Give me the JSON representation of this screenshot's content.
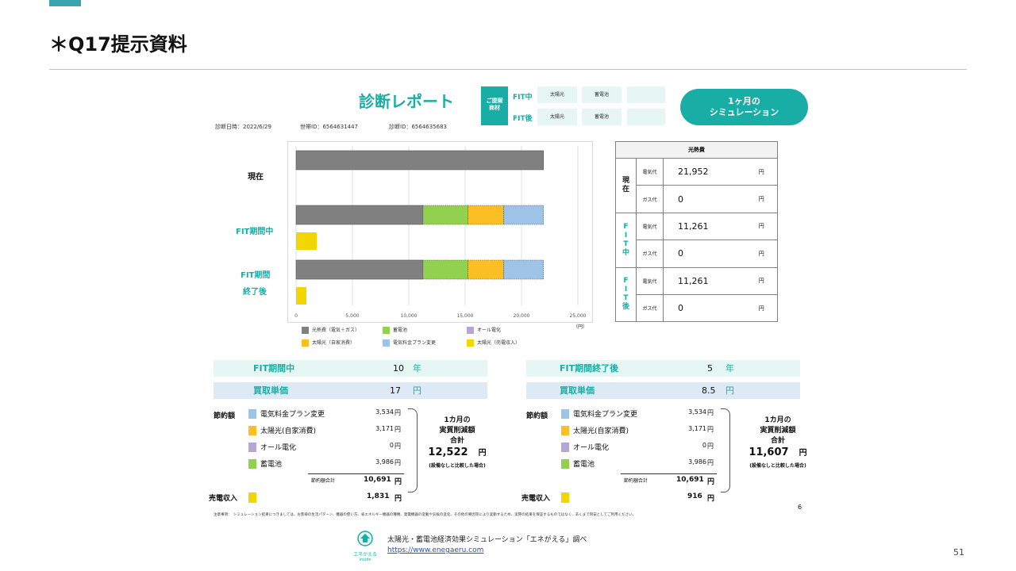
{
  "slide": {
    "title": "＊Q17提示資料",
    "page_number": "51"
  },
  "report": {
    "title": "診断レポート",
    "proposal_label": "ご提案商材",
    "fit_during": "FIT中",
    "fit_after": "FIT後",
    "proposal_items": [
      "太陽光",
      "蓄電池",
      ""
    ],
    "sim_button": [
      "1ヶ月の",
      "シミュレーション"
    ],
    "diag_date": "診断日時：2022/6/29",
    "household_id": "世帯ID：6564631447",
    "diag_id": "診断ID：6564635683"
  },
  "chart_labels": {
    "current": "現在",
    "fit_during": "FIT期間中",
    "fit_after_1": "FIT期間",
    "fit_after_2": "終了後",
    "unit": "（円）"
  },
  "chart_data": {
    "type": "bar",
    "orientation": "horizontal",
    "stacked": true,
    "xlim": [
      0,
      25000
    ],
    "x_ticks": [
      "0",
      "5,000",
      "10,000",
      "15,000",
      "20,000",
      "25,000"
    ],
    "categories": [
      "現在",
      "FIT期間中",
      "FIT期間中（売電）",
      "FIT期間終了後",
      "FIT期間終了後（売電）"
    ],
    "series": [
      {
        "name": "光熱費（電気＋ガス）",
        "color": "#808080",
        "values": [
          21952,
          11261,
          0,
          11261,
          0
        ]
      },
      {
        "name": "蓄電池",
        "color": "#92d050",
        "values": [
          0,
          3986,
          0,
          3986,
          0
        ]
      },
      {
        "name": "オール電化",
        "color": "#b4a7d6",
        "values": [
          0,
          0,
          0,
          0,
          0
        ]
      },
      {
        "name": "太陽光（自家消費）",
        "color": "#fbbf24",
        "values": [
          0,
          3171,
          0,
          3171,
          0
        ]
      },
      {
        "name": "電気料金プラン変更",
        "color": "#9dc3e6",
        "values": [
          0,
          3534,
          0,
          3534,
          0
        ]
      },
      {
        "name": "太陽光（売電収入）",
        "color": "#f2d600",
        "values": [
          0,
          0,
          1831,
          0,
          916
        ]
      }
    ]
  },
  "cost_table": {
    "header": "光熱費",
    "yen": "円",
    "groups": [
      {
        "label": "現\n在",
        "rows": [
          {
            "kind": "電気代",
            "value": "21,952"
          },
          {
            "kind": "ガス代",
            "value": "0"
          }
        ]
      },
      {
        "label": "F\nI\nT\n中",
        "rows": [
          {
            "kind": "電気代",
            "value": "11,261"
          },
          {
            "kind": "ガス代",
            "value": "0"
          }
        ]
      },
      {
        "label": "F\nI\nT\n後",
        "rows": [
          {
            "kind": "電気代",
            "value": "11,261"
          },
          {
            "kind": "ガス代",
            "value": "0"
          }
        ]
      }
    ]
  },
  "left_panel": {
    "period_label": "FIT期間中",
    "period_value": "10",
    "period_unit": "年",
    "price_label": "買取単価",
    "price_value": "17",
    "price_unit": "円",
    "savings_label": "節約額",
    "items": [
      {
        "name": "電気料金プラン変更",
        "value": "3,534",
        "color": "#9dc3e6"
      },
      {
        "name": "太陽光(自家消費)",
        "value": "3,171",
        "color": "#fbbf24"
      },
      {
        "name": "オール電化",
        "value": "0",
        "color": "#b4a7d6"
      },
      {
        "name": "蓄電池",
        "value": "3,986",
        "color": "#92d050"
      }
    ],
    "yen": "円",
    "total_label": "節約額合計",
    "total_value": "10,691",
    "sale_label": "売電収入",
    "sale_value": "1,831",
    "summary_lines": [
      "1カ月の",
      "実質削減額",
      "合計"
    ],
    "summary_value": "12,522",
    "summary_unit": "円",
    "summary_note": "(設備なしと比較した場合)"
  },
  "right_panel": {
    "period_label": "FIT期間終了後",
    "period_value": "5",
    "period_unit": "年",
    "price_label": "買取単価",
    "price_value": "8.5",
    "price_unit": "円",
    "savings_label": "節約額",
    "items": [
      {
        "name": "電気料金プラン変更",
        "value": "3,534",
        "color": "#9dc3e6"
      },
      {
        "name": "太陽光(自家消費)",
        "value": "3,171",
        "color": "#fbbf24"
      },
      {
        "name": "オール電化",
        "value": "0",
        "color": "#b4a7d6"
      },
      {
        "name": "蓄電池",
        "value": "3,986",
        "color": "#92d050"
      }
    ],
    "yen": "円",
    "total_label": "節約額合計",
    "total_value": "10,691",
    "sale_label": "売電収入",
    "sale_value": "916",
    "summary_lines": [
      "1カ月の",
      "実質削減額",
      "合計"
    ],
    "summary_value": "11,607",
    "summary_unit": "円",
    "summary_note": "(設備なしと比較した場合)"
  },
  "report_page": "6",
  "notice": "注意事項：　シミュレーション結果につきましては、お客様の生活パターン、機器の使い方、省エネルギー機器の種類、発電機器の変動や気候の変化、その他の要因等により変動するため、実際の結果を保証するものではなく、あくまで目安としてご利用ください。",
  "footer": {
    "source": "太陽光・蓄電池経済効果シミュレーション「エネがえる」調べ",
    "url": "https://www.enegaeru.com",
    "logo_text": "エネがえる",
    "logo_sub": "inside"
  }
}
